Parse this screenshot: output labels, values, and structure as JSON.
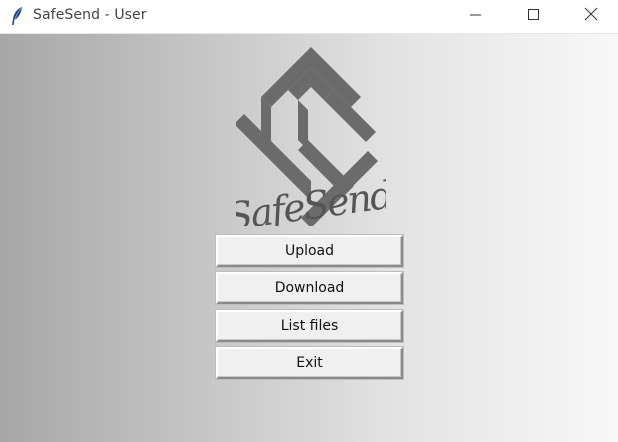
{
  "window": {
    "title": "SafeSend - User"
  },
  "logo": {
    "text": "SafeSend",
    "color": "#6b6b6b"
  },
  "buttons": {
    "upload": "Upload",
    "download": "Download",
    "list_files": "List files",
    "exit": "Exit"
  },
  "icons": {
    "app": "feather-icon",
    "minimize": "minimize-icon",
    "maximize": "maximize-icon",
    "close": "close-icon"
  }
}
